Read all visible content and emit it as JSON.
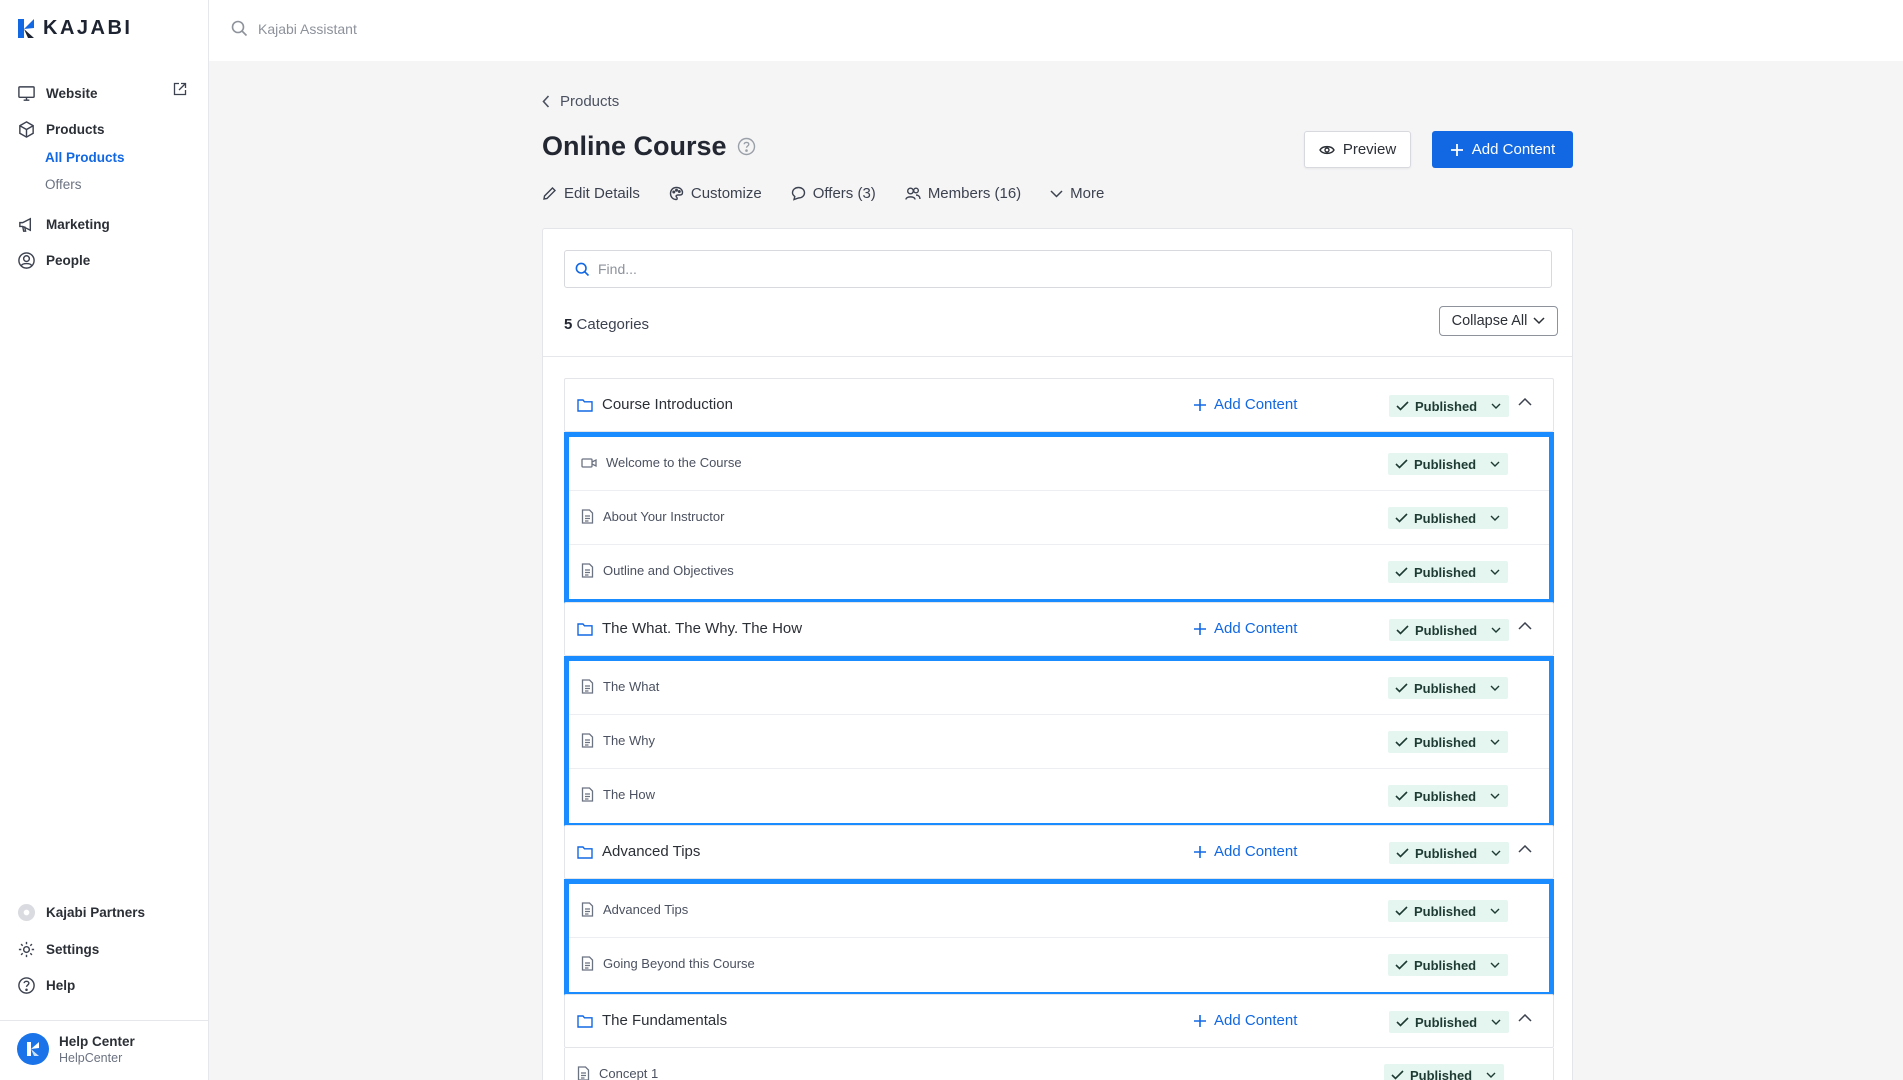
{
  "brand": {
    "name": "KAJABI",
    "accent": "#1268e3",
    "highlight": "#1a8cff"
  },
  "topbar": {
    "search_placeholder": "Kajabi Assistant"
  },
  "sidebar": {
    "website": "Website",
    "products": "Products",
    "all_products": "All Products",
    "offers": "Offers",
    "marketing": "Marketing",
    "people": "People",
    "partners": "Kajabi Partners",
    "settings": "Settings",
    "help": "Help",
    "help_center_title": "Help Center",
    "help_center_sub": "HelpCenter"
  },
  "page": {
    "breadcrumb": "Products",
    "title": "Online Course",
    "preview_label": "Preview",
    "add_content_label": "Add Content",
    "tabs": {
      "edit": "Edit Details",
      "customize": "Customize",
      "offers": "Offers (3)",
      "members": "Members (16)",
      "more": "More"
    }
  },
  "content": {
    "find_placeholder": "Find...",
    "category_count": "5",
    "category_count_label": "Categories",
    "collapse_all_label": "Collapse All",
    "add_content_label": "Add Content",
    "status_label": "Published",
    "categories": [
      {
        "title": "Course Introduction",
        "lessons": [
          "Welcome to the Course",
          "About Your Instructor",
          "Outline and Objectives"
        ]
      },
      {
        "title": "The What. The Why. The How",
        "lessons": [
          "The What",
          "The Why",
          "The How"
        ]
      },
      {
        "title": "Advanced Tips",
        "lessons": [
          "Advanced Tips",
          "Going Beyond this Course"
        ]
      },
      {
        "title": "The Fundamentals",
        "lessons": [
          "Concept 1"
        ]
      }
    ]
  }
}
